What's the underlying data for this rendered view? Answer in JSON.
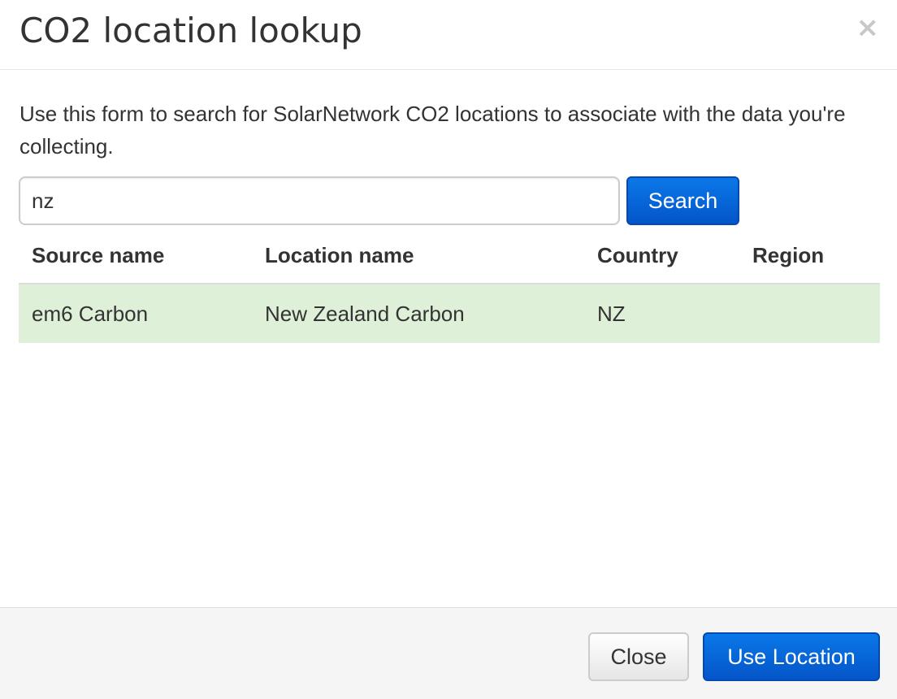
{
  "dialog": {
    "title": "CO2 location lookup",
    "close_glyph": "×",
    "close_icon": "close-icon"
  },
  "intro_text": "Use this form to search for SolarNetwork CO2 locations to associate with the data you're collecting.",
  "search": {
    "value": "nz",
    "placeholder": "",
    "button_label": "Search"
  },
  "table": {
    "headers": {
      "source": "Source name",
      "location": "Location name",
      "country": "Country",
      "region": "Region"
    },
    "rows": [
      {
        "source": "em6 Carbon",
        "location": "New Zealand Carbon",
        "country": "NZ",
        "region": "",
        "selected": true
      }
    ]
  },
  "footer": {
    "close_label": "Close",
    "use_label": "Use Location"
  },
  "colors": {
    "primary": "#0455c9",
    "selected_row": "#dff0d8",
    "footer_bg": "#f5f5f5"
  }
}
